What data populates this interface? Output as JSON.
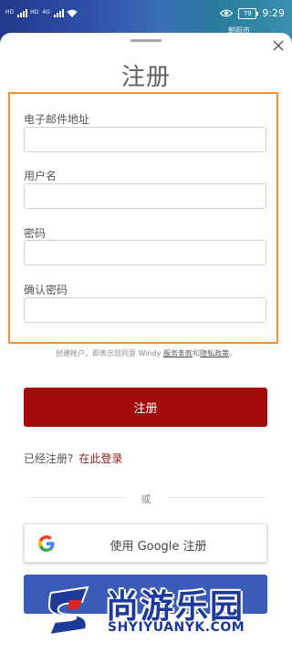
{
  "status_bar": {
    "signal1_tag": "HD",
    "signal2_tag": "HD",
    "network_tag": "4G",
    "battery": "79",
    "time": "9:29"
  },
  "map": {
    "label": "朝阳市"
  },
  "dialog": {
    "title": "注册",
    "fields": [
      {
        "label": "电子邮件地址",
        "value": "",
        "placeholder": ""
      },
      {
        "label": "用户名",
        "value": "",
        "placeholder": ""
      },
      {
        "label": "密码",
        "value": "",
        "placeholder": ""
      },
      {
        "label": "确认密码",
        "value": "",
        "placeholder": ""
      }
    ],
    "terms_prefix": "创建帐户，即表示您同意 Windy ",
    "terms_link": "服务条款",
    "terms_and": "和",
    "privacy_link": "隐私政策",
    "terms_suffix": "。",
    "register_label": "注册",
    "already_registered": "已经注册?",
    "login_link": "在此登录",
    "or_label": "或",
    "google_label": "使用 Google 注册"
  },
  "watermark": {
    "title": "尚游乐园",
    "url": "SHYIYUANYK.COM"
  },
  "colors": {
    "accent_red": "#a30b0b",
    "highlight_orange": "#f5922b",
    "facebook_blue": "#3b5bb8",
    "watermark_blue": "#1d3a9a"
  }
}
